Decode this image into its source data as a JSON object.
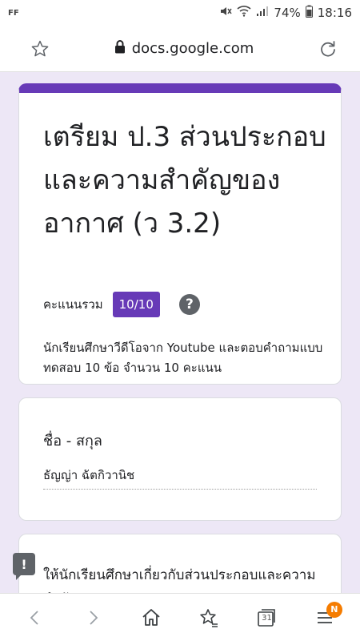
{
  "status_bar": {
    "left_label": "FF",
    "battery": "74%",
    "time": "18:16"
  },
  "browser": {
    "url": "docs.google.com"
  },
  "form": {
    "title": "เตรียม ป.3 ส่วนประกอบและความสำคัญของอากาศ (ว 3.2)",
    "score_label": "คะแนนรวม",
    "score_value": "10/10",
    "description": "นักเรียนศึกษาวีดีโอจาก Youtube และตอบคำถามแบบทดสอบ 10 ข้อ จำนวน 10 คะแนน",
    "accent_color": "#673ab7"
  },
  "name_question": {
    "title": "ชื่อ - สกุล",
    "answer": "ธัญญ่า  ฉัตกิวานิช"
  },
  "info": {
    "text": "ให้นักเรียนศึกษาเกี่ยวกับส่วนประกอบและความสำคัญของอากาศจาก Youtube"
  },
  "bottom_nav": {
    "calendar_label": "31",
    "menu_badge": "N"
  }
}
